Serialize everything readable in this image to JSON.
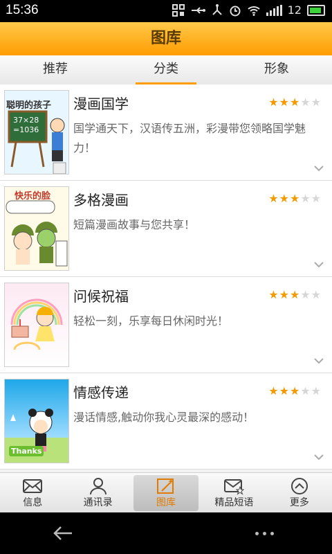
{
  "status_bar": {
    "time": "15:36",
    "battery_level": "12"
  },
  "header": {
    "title": "图库"
  },
  "tabs": [
    {
      "label": "推荐",
      "active": false
    },
    {
      "label": "分类",
      "active": true
    },
    {
      "label": "形象",
      "active": false
    }
  ],
  "items": [
    {
      "title": "漫画国学",
      "desc": "国学通天下，汉语传五洲，彩漫带您领略国学魅力！",
      "rating": 3,
      "thumb_text": "聪明的孩子",
      "thumb_sub": "37×28\n=1036"
    },
    {
      "title": "多格漫画",
      "desc": "短篇漫画故事与您共享！",
      "rating": 3,
      "thumb_text": "快乐的脸"
    },
    {
      "title": "问候祝福",
      "desc": "轻松一刻，乐享每日休闲时光！",
      "rating": 3
    },
    {
      "title": "情感传递",
      "desc": "漫话情感,触动你我心灵最深的感动！",
      "rating": 3,
      "thumb_text": "Thanks"
    }
  ],
  "bottom_nav": [
    {
      "label": "信息",
      "icon": "envelope-icon"
    },
    {
      "label": "通讯录",
      "icon": "contact-icon"
    },
    {
      "label": "图库",
      "icon": "magic-wand-icon",
      "active": true
    },
    {
      "label": "精品短语",
      "icon": "star-mail-icon"
    },
    {
      "label": "更多",
      "icon": "chevron-up-circle-icon"
    }
  ],
  "colors": {
    "accent": "#ff9c00",
    "star": "#f29a00"
  }
}
